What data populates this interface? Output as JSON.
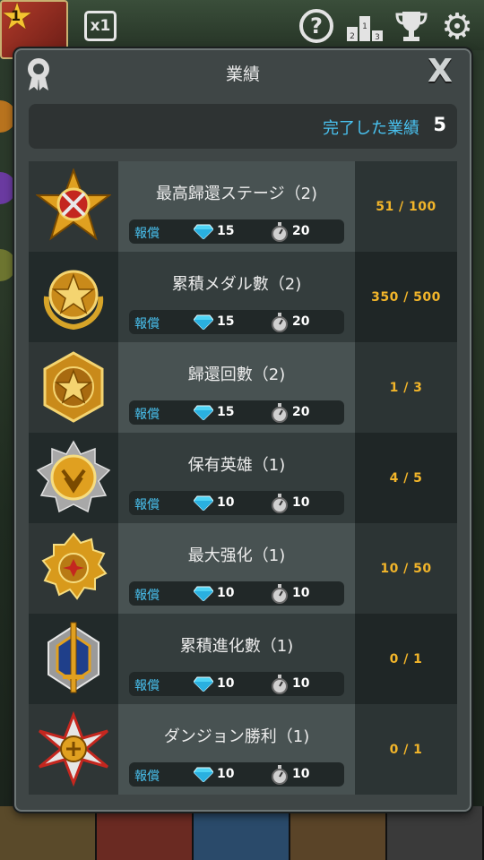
{
  "background": {
    "level_badge": "1",
    "speed_label": "x1",
    "help_icon": "question-icon",
    "rank_icon": "podium-icon",
    "trophy_icon": "trophy-icon",
    "settings_icon": "gear-icon"
  },
  "dialog": {
    "title": "業績",
    "close_label": "X",
    "summary": {
      "label": "完了した業績",
      "count": "5"
    },
    "achievements": [
      {
        "name": "最高歸還ステージ（2)",
        "reward_label": "報償",
        "gems": "15",
        "stopwatch": "20",
        "progress": "51 / 100",
        "medal": "sword-medal-icon"
      },
      {
        "name": "累積メダル數（2)",
        "reward_label": "報償",
        "gems": "15",
        "stopwatch": "20",
        "progress": "350 / 500",
        "medal": "laurel-star-medal-icon"
      },
      {
        "name": "歸還回數（2)",
        "reward_label": "報償",
        "gems": "15",
        "stopwatch": "20",
        "progress": "1 / 3",
        "medal": "winged-star-medal-icon"
      },
      {
        "name": "保有英雄（1)",
        "reward_label": "報償",
        "gems": "10",
        "stopwatch": "10",
        "progress": "4 / 5",
        "medal": "chevron-medal-icon"
      },
      {
        "name": "最大强化（1)",
        "reward_label": "報償",
        "gems": "10",
        "stopwatch": "10",
        "progress": "10 / 50",
        "medal": "gear-medal-icon"
      },
      {
        "name": "累積進化數（1)",
        "reward_label": "報償",
        "gems": "10",
        "stopwatch": "10",
        "progress": "0 / 1",
        "medal": "sword-cross-medal-icon"
      },
      {
        "name": "ダンジョン勝利（1)",
        "reward_label": "報償",
        "gems": "10",
        "stopwatch": "10",
        "progress": "0 / 1",
        "medal": "maltese-cross-medal-icon"
      }
    ]
  },
  "colors": {
    "accent_blue": "#49c2f0",
    "progress_gold": "#f2b52a",
    "panel": "#3f4646"
  }
}
